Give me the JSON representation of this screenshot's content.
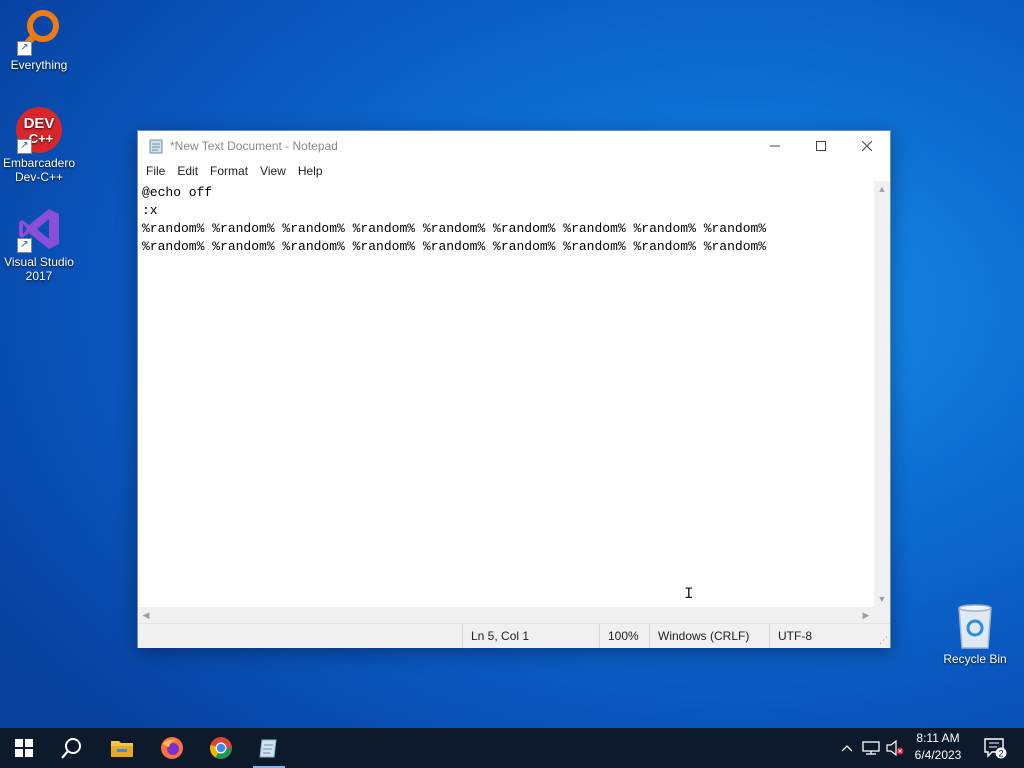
{
  "desktop": {
    "icons": [
      {
        "label_1": "Everything",
        "label_2": ""
      },
      {
        "label_1": "Embarcadero",
        "label_2": "Dev-C++"
      },
      {
        "label_1": "Visual Studio",
        "label_2": "2017"
      },
      {
        "label_1": "Recycle Bin",
        "label_2": ""
      }
    ],
    "devcpp_badge": {
      "line1": "DEV",
      "line2": "C++"
    }
  },
  "window": {
    "title": "*New Text Document - Notepad",
    "menu": [
      "File",
      "Edit",
      "Format",
      "View",
      "Help"
    ],
    "content": "@echo off\n:x\n%random% %random% %random% %random% %random% %random% %random% %random% %random%\n%random% %random% %random% %random% %random% %random% %random% %random% %random%",
    "status": {
      "position": "Ln 5, Col 1",
      "zoom": "100%",
      "line_ending": "Windows (CRLF)",
      "encoding": "UTF-8"
    }
  },
  "taskbar": {
    "items": [
      "windows-start-icon",
      "search-icon",
      "file-explorer-icon",
      "firefox-icon",
      "chrome-icon",
      "notepad-icon"
    ],
    "clock": {
      "time": "8:11 AM",
      "date": "6/4/2023"
    },
    "notification_count": "2"
  },
  "colors": {
    "taskbar_bg": "#0c1a2b",
    "desktop_blue": "#0d6fd3",
    "active_indicator": "#7fb6ec"
  }
}
